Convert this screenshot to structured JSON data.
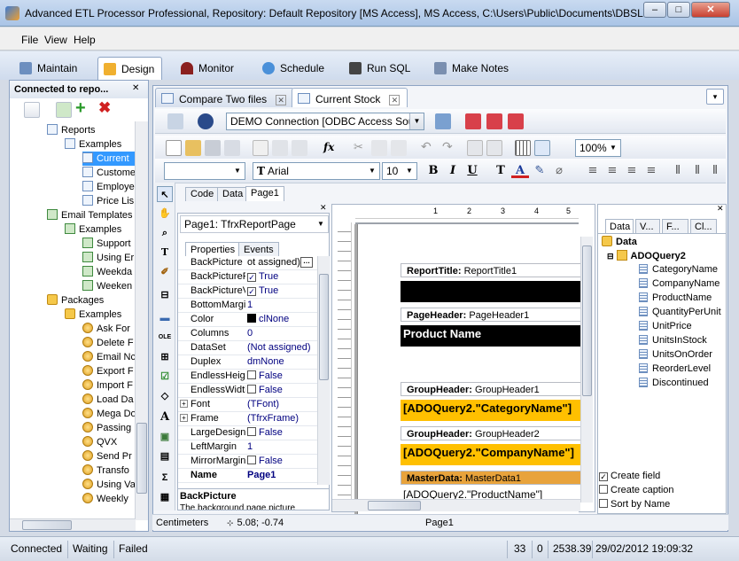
{
  "window": {
    "title": "Advanced ETL Processor Professional, Repository: Default Repository  [MS Access], MS Access, C:\\Users\\Public\\Documents\\DBSL\\..."
  },
  "menu": [
    "File",
    "View",
    "Help"
  ],
  "ribbon_tabs": [
    {
      "label": "Maintain",
      "active": false
    },
    {
      "label": "Design",
      "active": true
    },
    {
      "label": "Monitor",
      "active": false
    },
    {
      "label": "Schedule",
      "active": false
    },
    {
      "label": "Run SQL",
      "active": false
    },
    {
      "label": "Make Notes",
      "active": false
    }
  ],
  "left_panel": {
    "title": "Connected to repo...",
    "tree": [
      {
        "label": "Reports",
        "level": 1,
        "icon": "folder"
      },
      {
        "label": "Examples",
        "level": 2,
        "icon": "folder"
      },
      {
        "label": "Current",
        "level": 3,
        "icon": "report",
        "selected": true
      },
      {
        "label": "Custome",
        "level": 3,
        "icon": "report"
      },
      {
        "label": "Employe",
        "level": 3,
        "icon": "report"
      },
      {
        "label": "Price Lis",
        "level": 3,
        "icon": "report"
      },
      {
        "label": "Email Templates",
        "level": 1,
        "icon": "mail"
      },
      {
        "label": "Examples",
        "level": 2,
        "icon": "mail"
      },
      {
        "label": "Support",
        "level": 3,
        "icon": "mail"
      },
      {
        "label": "Using Er",
        "level": 3,
        "icon": "mail"
      },
      {
        "label": "Weekda",
        "level": 3,
        "icon": "mail"
      },
      {
        "label": "Weeken",
        "level": 3,
        "icon": "mail"
      },
      {
        "label": "Packages",
        "level": 1,
        "icon": "package"
      },
      {
        "label": "Examples",
        "level": 2,
        "icon": "package"
      },
      {
        "label": "Ask For",
        "level": 3,
        "icon": "gear"
      },
      {
        "label": "Delete F",
        "level": 3,
        "icon": "gear"
      },
      {
        "label": "Email Nc",
        "level": 3,
        "icon": "gear"
      },
      {
        "label": "Export F",
        "level": 3,
        "icon": "gear"
      },
      {
        "label": "Import F",
        "level": 3,
        "icon": "gear"
      },
      {
        "label": "Load Da",
        "level": 3,
        "icon": "gear"
      },
      {
        "label": "Mega Do",
        "level": 3,
        "icon": "gear"
      },
      {
        "label": "Passing",
        "level": 3,
        "icon": "gear"
      },
      {
        "label": "QVX",
        "level": 3,
        "icon": "gear"
      },
      {
        "label": "Send Pr",
        "level": 3,
        "icon": "gear"
      },
      {
        "label": "Transfo",
        "level": 3,
        "icon": "gear"
      },
      {
        "label": "Using Va",
        "level": 3,
        "icon": "gear"
      },
      {
        "label": "Weekly",
        "level": 3,
        "icon": "gear"
      }
    ]
  },
  "doc_tabs": [
    {
      "label": "Compare Two files",
      "active": false
    },
    {
      "label": "Current Stock",
      "active": true
    }
  ],
  "connection": {
    "value": "DEMO Connection [ODBC Access Source"
  },
  "zoom": "100%",
  "font": {
    "name": "Arial",
    "size": "10"
  },
  "report_tabs": [
    "Code",
    "Data",
    "Page1"
  ],
  "props_panel": {
    "object": "Page1: TfrxReportPage",
    "tabs": [
      "Properties",
      "Events"
    ],
    "rows": [
      {
        "name": "BackPicture",
        "value": "ot assigned)",
        "type": "text"
      },
      {
        "name": "BackPicturePr",
        "value": "True",
        "type": "check"
      },
      {
        "name": "BackPictureVi",
        "value": "True",
        "type": "check"
      },
      {
        "name": "BottomMargin",
        "value": "1",
        "type": "text"
      },
      {
        "name": "Color",
        "value": "clNone",
        "type": "color"
      },
      {
        "name": "Columns",
        "value": "0",
        "type": "text"
      },
      {
        "name": "DataSet",
        "value": "(Not assigned)",
        "type": "text"
      },
      {
        "name": "Duplex",
        "value": "dmNone",
        "type": "text"
      },
      {
        "name": "EndlessHeigh",
        "value": "False",
        "type": "uncheck"
      },
      {
        "name": "EndlessWidth",
        "value": "False",
        "type": "uncheck"
      },
      {
        "name": "Font",
        "value": "(TFont)",
        "type": "expand"
      },
      {
        "name": "Frame",
        "value": "(TfrxFrame)",
        "type": "expand"
      },
      {
        "name": "LargeDesignH",
        "value": "False",
        "type": "uncheck"
      },
      {
        "name": "LeftMargin",
        "value": "1",
        "type": "text"
      },
      {
        "name": "MirrorMargins",
        "value": "False",
        "type": "uncheck"
      },
      {
        "name": "Name",
        "value": "Page1",
        "type": "bold"
      }
    ],
    "help_title": "BackPicture",
    "help_text": "The background page picture"
  },
  "ruler": [
    "1",
    "2",
    "3",
    "4",
    "5"
  ],
  "bands": [
    {
      "kind": "ReportTitle:",
      "name": "ReportTitle1",
      "memo": ""
    },
    {
      "kind": "PageHeader:",
      "name": "PageHeader1",
      "memo": "Product Name"
    },
    {
      "kind": "GroupHeader:",
      "name": "GroupHeader1",
      "memo": "[ADOQuery2.\"CategoryName\"]"
    },
    {
      "kind": "GroupHeader:",
      "name": "GroupHeader2",
      "memo": "[ADOQuery2.\"CompanyName\"]"
    },
    {
      "kind": "MasterData:",
      "name": "MasterData1",
      "memo": "[ADOQuery2.\"ProductName\"]"
    }
  ],
  "data_panel": {
    "tabs": [
      "Data",
      "V...",
      "F...",
      "Cl..."
    ],
    "root": "Data",
    "query": "ADOQuery2",
    "fields": [
      "CategoryName",
      "CompanyName",
      "ProductName",
      "QuantityPerUnit",
      "UnitPrice",
      "UnitsInStock",
      "UnitsOnOrder",
      "ReorderLevel",
      "Discontinued"
    ],
    "options": [
      {
        "label": "Create field",
        "checked": true
      },
      {
        "label": "Create caption",
        "checked": false
      },
      {
        "label": "Sort by Name",
        "checked": false
      }
    ]
  },
  "designer_status": {
    "units": "Centimeters",
    "coords": "5.08; -0.74",
    "page": "Page1"
  },
  "status": {
    "connected": "Connected",
    "waiting": "Waiting",
    "failed": "Failed",
    "count1": "33",
    "count2": "0",
    "value": "2538.39",
    "datetime": "29/02/2012 19:09:32"
  },
  "colors": {
    "accent": "#3399ff",
    "band_black": "#000000",
    "band_yellow": "#ffc000",
    "master_band": "#e8a33c"
  }
}
